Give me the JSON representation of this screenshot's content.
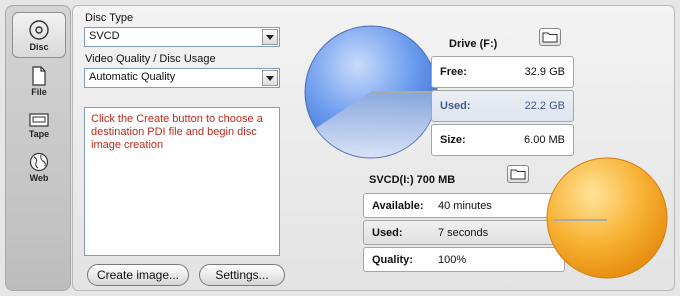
{
  "sidebar": {
    "items": [
      {
        "label": "Disc",
        "icon": "disc-icon",
        "active": true
      },
      {
        "label": "File",
        "icon": "file-icon",
        "active": false
      },
      {
        "label": "Tape",
        "icon": "tape-icon",
        "active": false
      },
      {
        "label": "Web",
        "icon": "web-icon",
        "active": false
      }
    ]
  },
  "form": {
    "disc_type_label": "Disc Type",
    "disc_type_value": "SVCD",
    "quality_label": "Video Quality / Disc Usage",
    "quality_value": "Automatic Quality",
    "message": "Click the Create button to choose a destination PDI file and begin disc image creation",
    "create_button": "Create image...",
    "settings_button": "Settings..."
  },
  "drive": {
    "title": "Drive (F:)",
    "rows": [
      {
        "key": "Free:",
        "value": "32.9 GB"
      },
      {
        "key": "Used:",
        "value": "22.2 GB"
      },
      {
        "key": "Size:",
        "value": "6.00 MB"
      }
    ]
  },
  "disc": {
    "title": "SVCD(I:) 700 MB",
    "rows": [
      {
        "key": "Available:",
        "value": "40 minutes"
      },
      {
        "key": "Used:",
        "value": "7 seconds"
      },
      {
        "key": "Quality:",
        "value": "100%"
      }
    ]
  },
  "colors": {
    "drive_globe": "#5b8fe6",
    "disc_globe": "#f7a81c",
    "message_text": "#c0291b",
    "highlight_text": "#3d5a8a"
  }
}
